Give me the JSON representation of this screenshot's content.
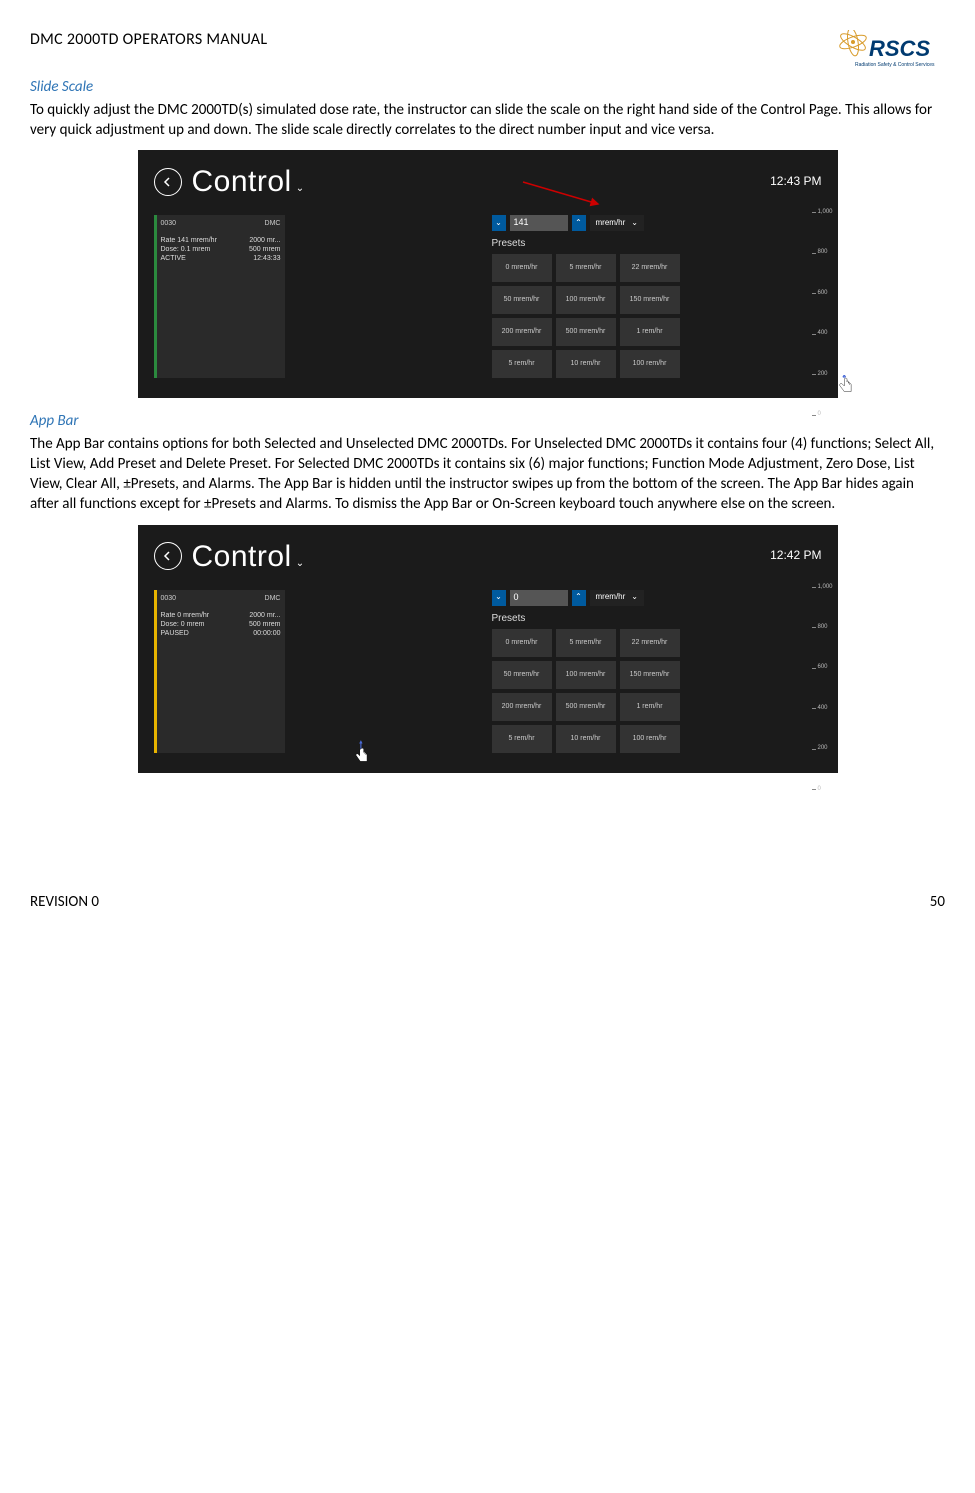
{
  "header": {
    "doc_title": "DMC 2000TD OPERATORS MANUAL",
    "logo_text": "RSCS",
    "logo_sub": "Radiation Safety & Control Services"
  },
  "s1": {
    "title": "Slide Scale",
    "body": "To quickly adjust the DMC 2000TD(s) simulated dose rate, the instructor can slide the scale on the right hand side of the Control Page. This allows for very quick adjustment up and down. The slide scale directly correlates to the direct number input and vice versa."
  },
  "s2": {
    "title": "App Bar",
    "body": "The App Bar contains options for both Selected and Unselected DMC 2000TDs. For Unselected DMC 2000TDs it contains four (4) functions; Select All, List View, Add Preset and Delete Preset. For Selected DMC 2000TDs it contains six (6) major functions; Function Mode Adjustment, Zero Dose, List View, Clear All, ±Presets, and Alarms. The App Bar is hidden until the instructor swipes up from the bottom of the screen. The App Bar hides again after all functions except for ±Presets and Alarms. To dismiss the App Bar or On-Screen keyboard touch anywhere else on the screen."
  },
  "shot_common": {
    "page_title": "Control",
    "presets_label": "Presets",
    "unit": "mrem/hr",
    "presets": [
      "0 mrem/hr",
      "5 mrem/hr",
      "22 mrem/hr",
      "50 mrem/hr",
      "100 mrem/hr",
      "150 mrem/hr",
      "200 mrem/hr",
      "500 mrem/hr",
      "1 rem/hr",
      "5 rem/hr",
      "10 rem/hr",
      "100 rem/hr"
    ],
    "scale": [
      "1,000",
      "800",
      "600",
      "400",
      "200",
      "0"
    ]
  },
  "shot1": {
    "clock": "12:43 PM",
    "rate_value": "141",
    "tile": {
      "id": "0030",
      "model": "DMC",
      "r1a": "Rate 141 mrem/hr",
      "r1b": "2000 mr...",
      "r2a": "Dose: 0.1 mrem",
      "r2b": "500 mrem",
      "r3a": "ACTIVE",
      "r3b": "12:43:33"
    }
  },
  "shot2": {
    "clock": "12:42 PM",
    "rate_value": "0",
    "tile": {
      "id": "0030",
      "model": "DMC",
      "r1a": "Rate 0 mrem/hr",
      "r1b": "2000 mr...",
      "r2a": "Dose: 0 mrem",
      "r2b": "500 mrem",
      "r3a": "PAUSED",
      "r3b": "00:00:00"
    }
  },
  "footer": {
    "rev": "REVISION 0",
    "page": "50"
  }
}
